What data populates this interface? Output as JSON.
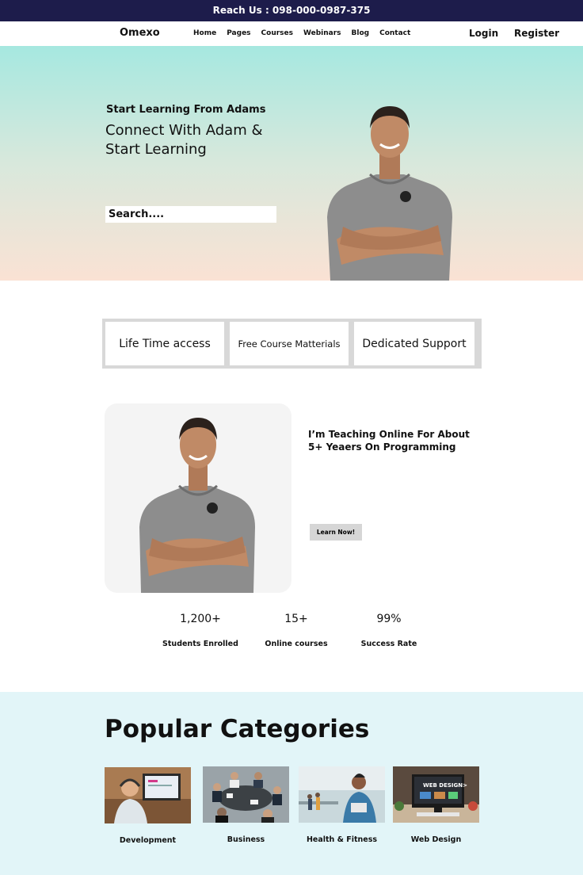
{
  "topbar": {
    "text": "Reach Us : 098-000-0987-375"
  },
  "nav": {
    "logo": "Omexo",
    "links": [
      "Home",
      "Pages",
      "Courses",
      "Webinars",
      "Blog",
      "Contact"
    ],
    "login": "Login",
    "register": "Register"
  },
  "hero": {
    "eyebrow": "Start Learning From Adams",
    "title": "Connect With Adam & Start Learning",
    "search_placeholder": "Search...."
  },
  "features": [
    "Life Time access",
    "Free Course Matterials",
    "Dedicated Support"
  ],
  "about": {
    "heading": "I’m Teaching Online For About 5+ Yeaers On Programming",
    "button": "Learn Now!"
  },
  "stats": [
    {
      "value": "1,200+",
      "label": "Students Enrolled"
    },
    {
      "value": "15+",
      "label": "Online courses"
    },
    {
      "value": "99%",
      "label": "Success Rate"
    }
  ],
  "categories": {
    "title": "Popular Categories",
    "items": [
      "Development",
      "Business",
      "Health & Fitness",
      "Web Design"
    ]
  },
  "colors": {
    "topbar_bg": "#1d1c4b",
    "hero_gradient_top": "#a6e8e0",
    "hero_gradient_bottom": "#fae2d4",
    "categories_bg": "#e2f5f8"
  }
}
